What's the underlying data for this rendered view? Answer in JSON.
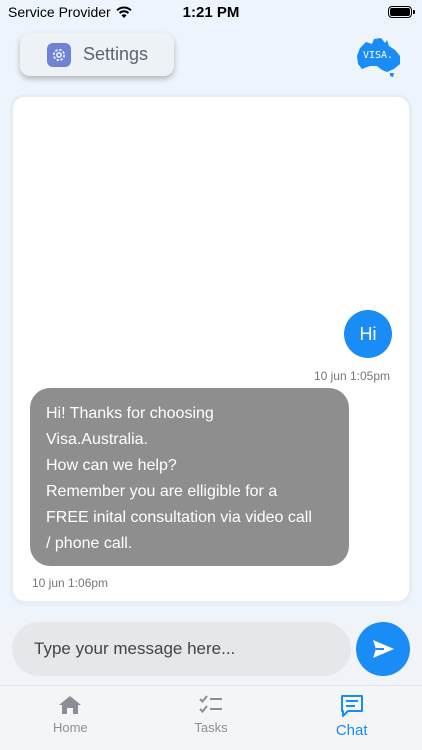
{
  "status_bar": {
    "carrier": "Service Provider",
    "time": "1:21 PM"
  },
  "header": {
    "settings_label": "Settings",
    "logo_text": "VISA."
  },
  "messages": [
    {
      "direction": "outgoing",
      "text": "Hi",
      "time": "10 jun 1:05pm"
    },
    {
      "direction": "incoming",
      "lines": [
        "Hi! Thanks for choosing",
        "Visa.Australia.",
        "How can we help?",
        "Remember you are elligible for a",
        "FREE inital consultation via video call",
        "/ phone call."
      ],
      "time": "10 jun 1:06pm"
    }
  ],
  "composer": {
    "placeholder": "Type your message here...",
    "value": ""
  },
  "tabs": [
    {
      "label": "Home",
      "icon": "home-icon",
      "active": false
    },
    {
      "label": "Tasks",
      "icon": "tasks-icon",
      "active": false
    },
    {
      "label": "Chat",
      "icon": "chat-icon",
      "active": true
    }
  ],
  "colors": {
    "accent": "#1a8cf5",
    "incoming_bubble": "#8e8e8e",
    "background": "#eef4fb"
  }
}
